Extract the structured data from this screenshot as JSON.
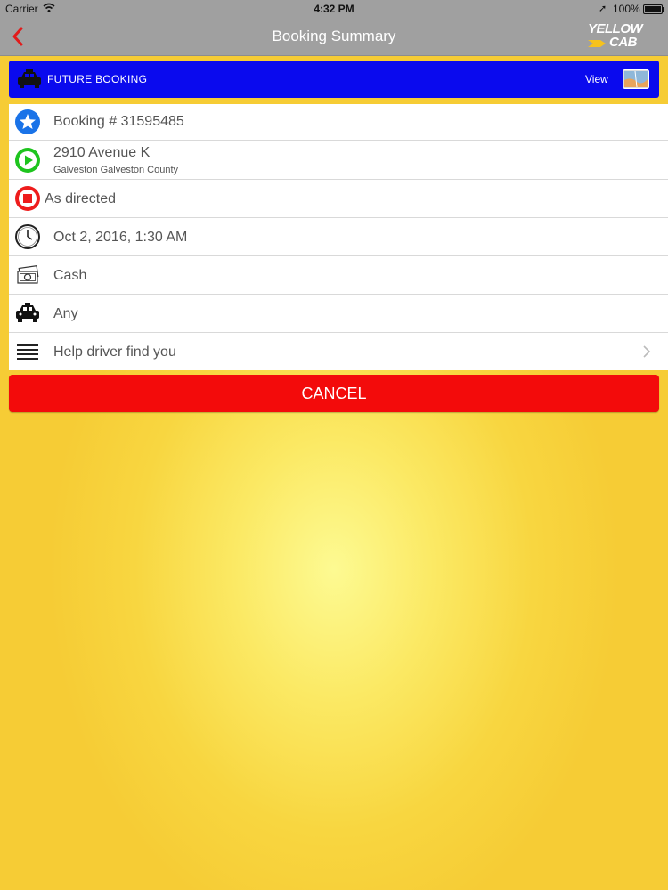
{
  "status_bar": {
    "carrier": "Carrier",
    "time": "4:32 PM",
    "battery": "100%"
  },
  "nav": {
    "title": "Booking Summary",
    "logo_line1": "YELLOW",
    "logo_line2": "CAB"
  },
  "banner": {
    "label": "FUTURE BOOKING",
    "view_label": "View"
  },
  "booking": {
    "number": "Booking # 31595485",
    "pickup_address": "2910 Avenue K",
    "pickup_area": "Galveston Galveston County",
    "destination": "As directed",
    "datetime": "Oct 2, 2016, 1:30 AM",
    "payment": "Cash",
    "vehicle": "Any",
    "help_label": "Help driver find you"
  },
  "actions": {
    "cancel_label": "CANCEL"
  },
  "colors": {
    "banner": "#0a0aee",
    "cancel": "#f30b0b",
    "background": "#f8d640",
    "navbar": "#a0a0a0"
  }
}
